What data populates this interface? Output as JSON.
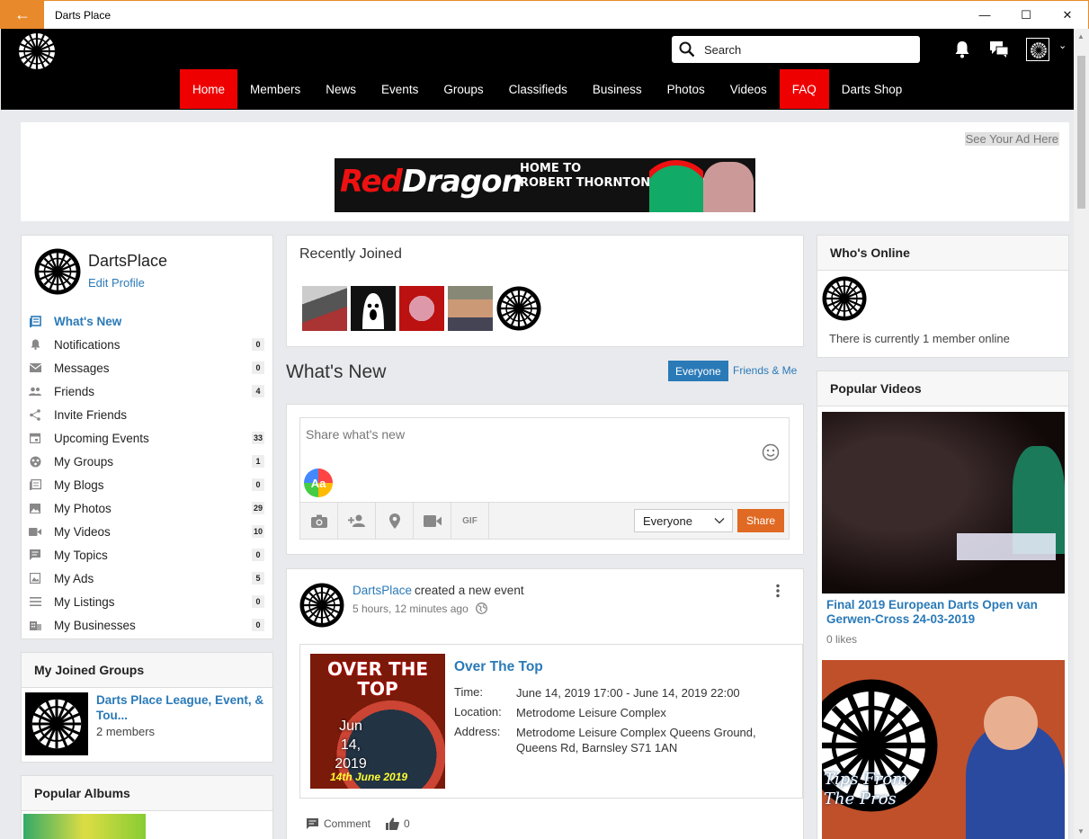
{
  "window": {
    "title": "Darts Place"
  },
  "search": {
    "placeholder": "Search"
  },
  "nav": [
    "Home",
    "Members",
    "News",
    "Events",
    "Groups",
    "Classifieds",
    "Business",
    "Photos",
    "Videos",
    "FAQ",
    "Darts Shop"
  ],
  "ad": {
    "link": "See Your Ad Here",
    "brand_a": "Red",
    "brand_b": "Dragon",
    "tag1": "HOME TO",
    "tag2": "ROBERT THORNTON'S DARTS"
  },
  "profile": {
    "name": "DartsPlace",
    "edit": "Edit Profile"
  },
  "menu": [
    {
      "label": "What's New",
      "icon": "news-icon",
      "badge": ""
    },
    {
      "label": "Notifications",
      "icon": "bell-icon",
      "badge": "0"
    },
    {
      "label": "Messages",
      "icon": "envelope-icon",
      "badge": "0"
    },
    {
      "label": "Friends",
      "icon": "friends-icon",
      "badge": "4"
    },
    {
      "label": "Invite Friends",
      "icon": "share-icon",
      "badge": ""
    },
    {
      "label": "Upcoming Events",
      "icon": "calendar-icon",
      "badge": "33"
    },
    {
      "label": "My Groups",
      "icon": "groups-icon",
      "badge": "1"
    },
    {
      "label": "My Blogs",
      "icon": "blog-icon",
      "badge": "0"
    },
    {
      "label": "My Photos",
      "icon": "photo-icon",
      "badge": "29"
    },
    {
      "label": "My Videos",
      "icon": "video-icon",
      "badge": "10"
    },
    {
      "label": "My Topics",
      "icon": "topic-icon",
      "badge": "0"
    },
    {
      "label": "My Ads",
      "icon": "ads-icon",
      "badge": "5"
    },
    {
      "label": "My Listings",
      "icon": "listing-icon",
      "badge": "0"
    },
    {
      "label": "My Businesses",
      "icon": "business-icon",
      "badge": "0"
    }
  ],
  "joined_groups": {
    "title": "My Joined Groups",
    "name": "Darts Place League, Event, & Tou...",
    "members": "2 members"
  },
  "popular_albums": {
    "title": "Popular Albums"
  },
  "recently_joined": {
    "title": "Recently Joined"
  },
  "whats_new": {
    "title": "What's New",
    "tab_everyone": "Everyone",
    "tab_friends": "Friends & Me"
  },
  "composer": {
    "placeholder": "Share what's new",
    "aa": "Aa",
    "gif": "GIF",
    "privacy": "Everyone",
    "share": "Share"
  },
  "feed": {
    "author": "DartsPlace",
    "action": "created a new event",
    "time": "5 hours, 12 minutes ago",
    "event": {
      "title": "Over The Top",
      "time_label": "Time:",
      "time_value": "June 14, 2019 17:00 - June 14, 2019 22:00",
      "location_label": "Location:",
      "location_value": "Metrodome Leisure Complex",
      "address_label": "Address:",
      "address_value": "Metrodome Leisure Complex Queens Ground, Queens Rd, Barnsley S71 1AN",
      "date_overlay": "Jun 14, 2019",
      "poster_title": "OVER THE TOP",
      "poster_date": "14th June 2019"
    },
    "comment": "Comment",
    "likes": "0"
  },
  "whos_online": {
    "title": "Who's Online",
    "text": "There is currently 1 member online"
  },
  "popular_videos": {
    "title": "Popular Videos",
    "video1_title": "Final 2019 European Darts Open van Gerwen-Cross 24-03-2019",
    "video1_likes": "0 likes",
    "video2_caption_a": "Tips From",
    "video2_caption_b": "The Pros"
  },
  "colors": {
    "accent": "#2a7ab8",
    "nav_active": "#ee0000",
    "window_accent": "#e8892b",
    "share": "#e06a24"
  }
}
